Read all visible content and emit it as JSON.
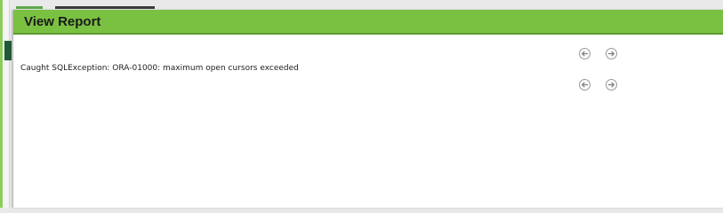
{
  "dialog": {
    "title": "View Report",
    "error_message": "Caught SQLException: ORA-01000: maximum open cursors exceeded"
  },
  "nav": {
    "top": {
      "prev_icon": "arrow-left-circle-icon",
      "next_icon": "arrow-right-circle-icon"
    },
    "bottom": {
      "prev_icon": "arrow-left-circle-icon",
      "next_icon": "arrow-right-circle-icon"
    }
  },
  "colors": {
    "titlebar": "#7ac142",
    "titlebar_border": "#5d9a30",
    "side_tab": "#1f5a37"
  }
}
